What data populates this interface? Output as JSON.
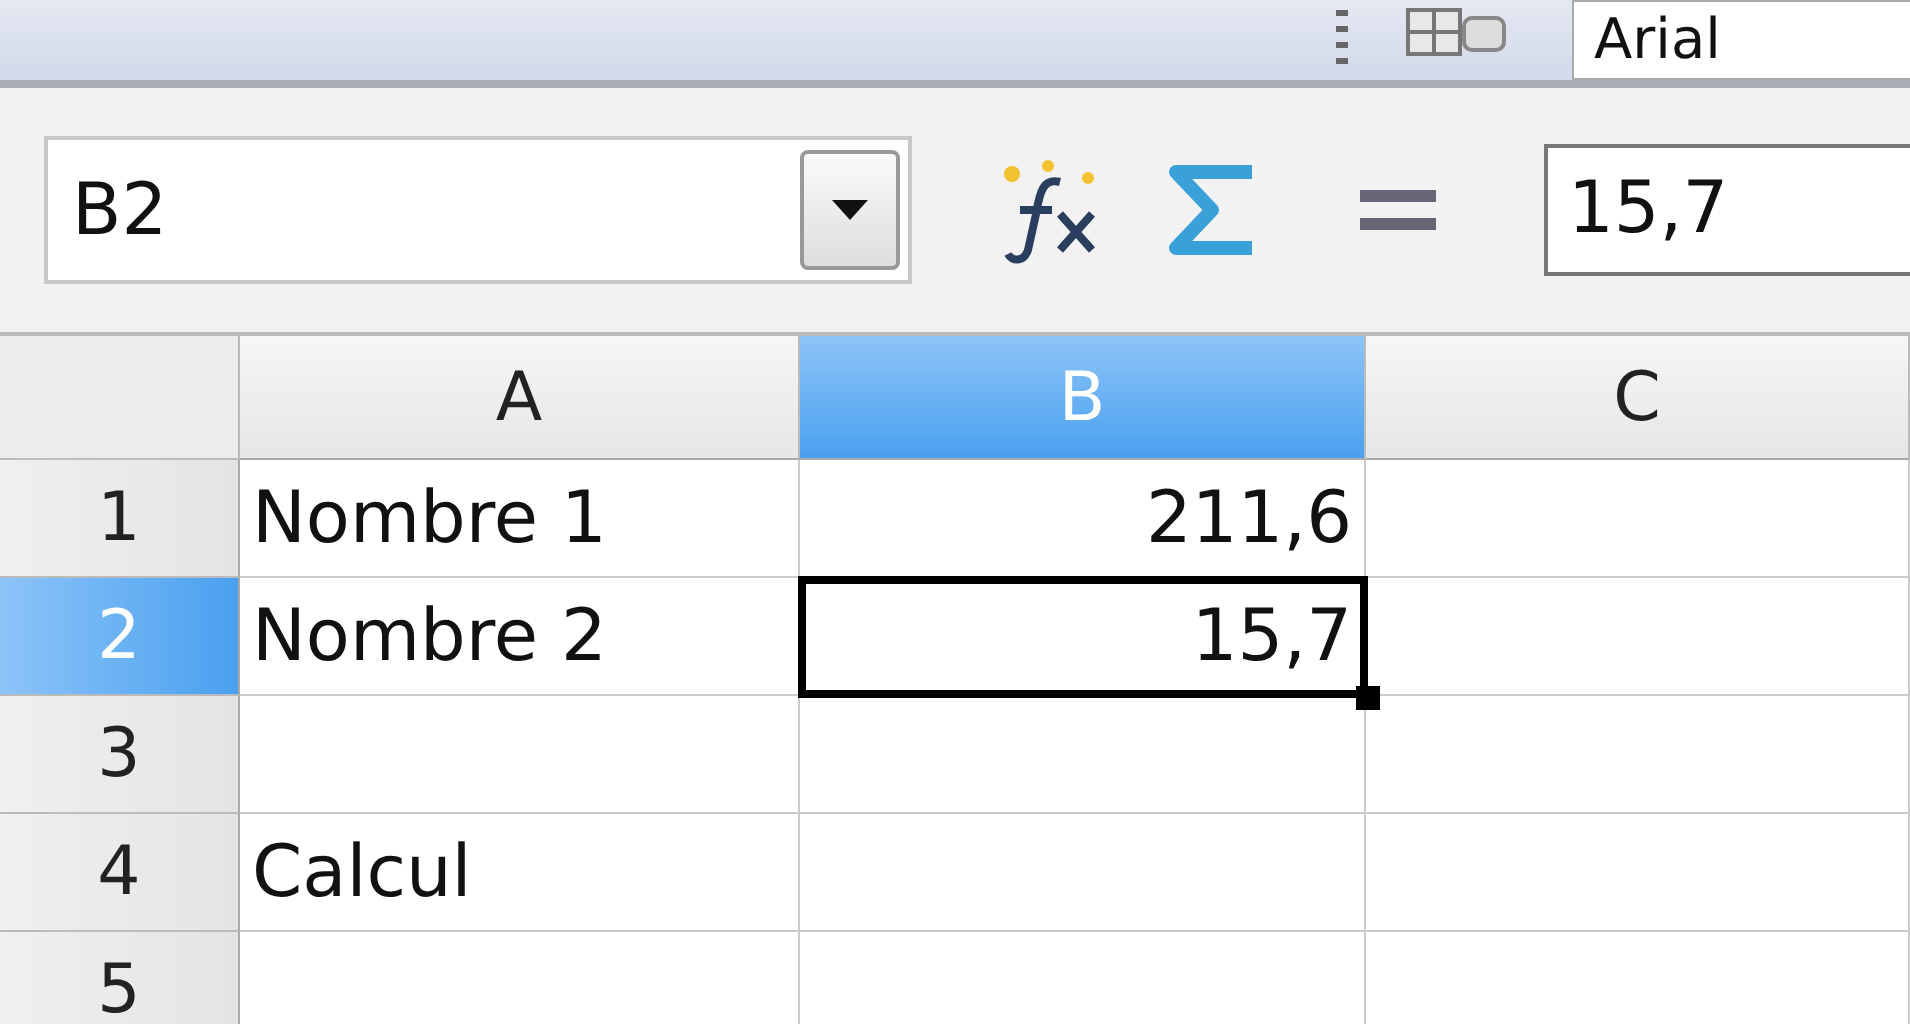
{
  "toolbar": {
    "font_name": "Arial"
  },
  "formula_bar": {
    "name_box": "B2",
    "formula": "15,7"
  },
  "columns": [
    {
      "label": "A",
      "selected": false
    },
    {
      "label": "B",
      "selected": true
    },
    {
      "label": "C",
      "selected": false
    }
  ],
  "rows": [
    {
      "label": "1",
      "selected": false,
      "cells": [
        {
          "text": "Nombre 1",
          "active": false
        },
        {
          "text": "211,6",
          "active": false
        },
        {
          "active": false
        }
      ]
    },
    {
      "label": "2",
      "selected": true,
      "cells": [
        {
          "text": "Nombre 2",
          "active": false
        },
        {
          "text": "15,7",
          "active": true
        },
        {
          "active": false
        }
      ]
    },
    {
      "label": "3",
      "selected": false,
      "cells": [
        {
          "active": false
        },
        {
          "active": false
        },
        {
          "active": false
        }
      ]
    },
    {
      "label": "4",
      "selected": false,
      "cells": [
        {
          "text": "Calcul",
          "active": false
        },
        {
          "active": false
        },
        {
          "active": false
        }
      ]
    },
    {
      "label": "5",
      "selected": false,
      "cells": [
        {
          "active": false
        },
        {
          "active": false
        },
        {
          "active": false
        }
      ]
    }
  ]
}
